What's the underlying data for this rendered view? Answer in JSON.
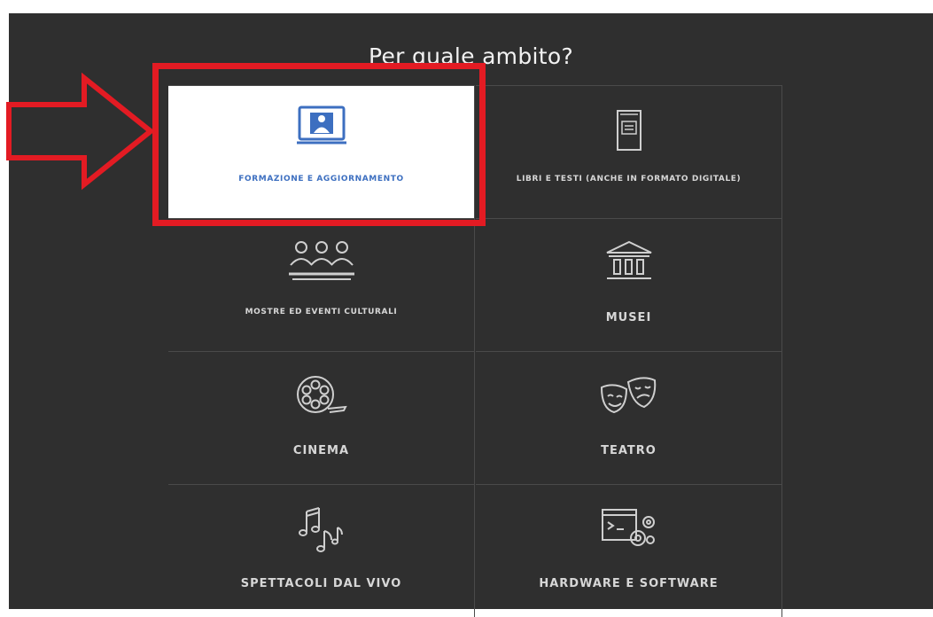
{
  "title": "Per quale ambito?",
  "categories": [
    {
      "label": "FORMAZIONE E AGGIORNAMENTO",
      "icon": "teacher-screen-icon",
      "selected": true
    },
    {
      "label": "LIBRI E TESTI (ANCHE IN FORMATO DIGITALE)",
      "icon": "book-icon",
      "selected": false
    },
    {
      "label": "MOSTRE ED EVENTI CULTURALI",
      "icon": "audience-icon",
      "selected": false
    },
    {
      "label": "MUSEI",
      "icon": "museum-icon",
      "selected": false
    },
    {
      "label": "CINEMA",
      "icon": "film-reel-icon",
      "selected": false
    },
    {
      "label": "TEATRO",
      "icon": "theatre-masks-icon",
      "selected": false
    },
    {
      "label": "SPETTACOLI DAL VIVO",
      "icon": "music-notes-icon",
      "selected": false
    },
    {
      "label": "HARDWARE E SOFTWARE",
      "icon": "hardware-software-icon",
      "selected": false
    }
  ],
  "colors": {
    "background": "#2f2f2f",
    "highlight": "#e31b23",
    "accent": "#3d6fc0",
    "text": "#d7d7d7"
  }
}
